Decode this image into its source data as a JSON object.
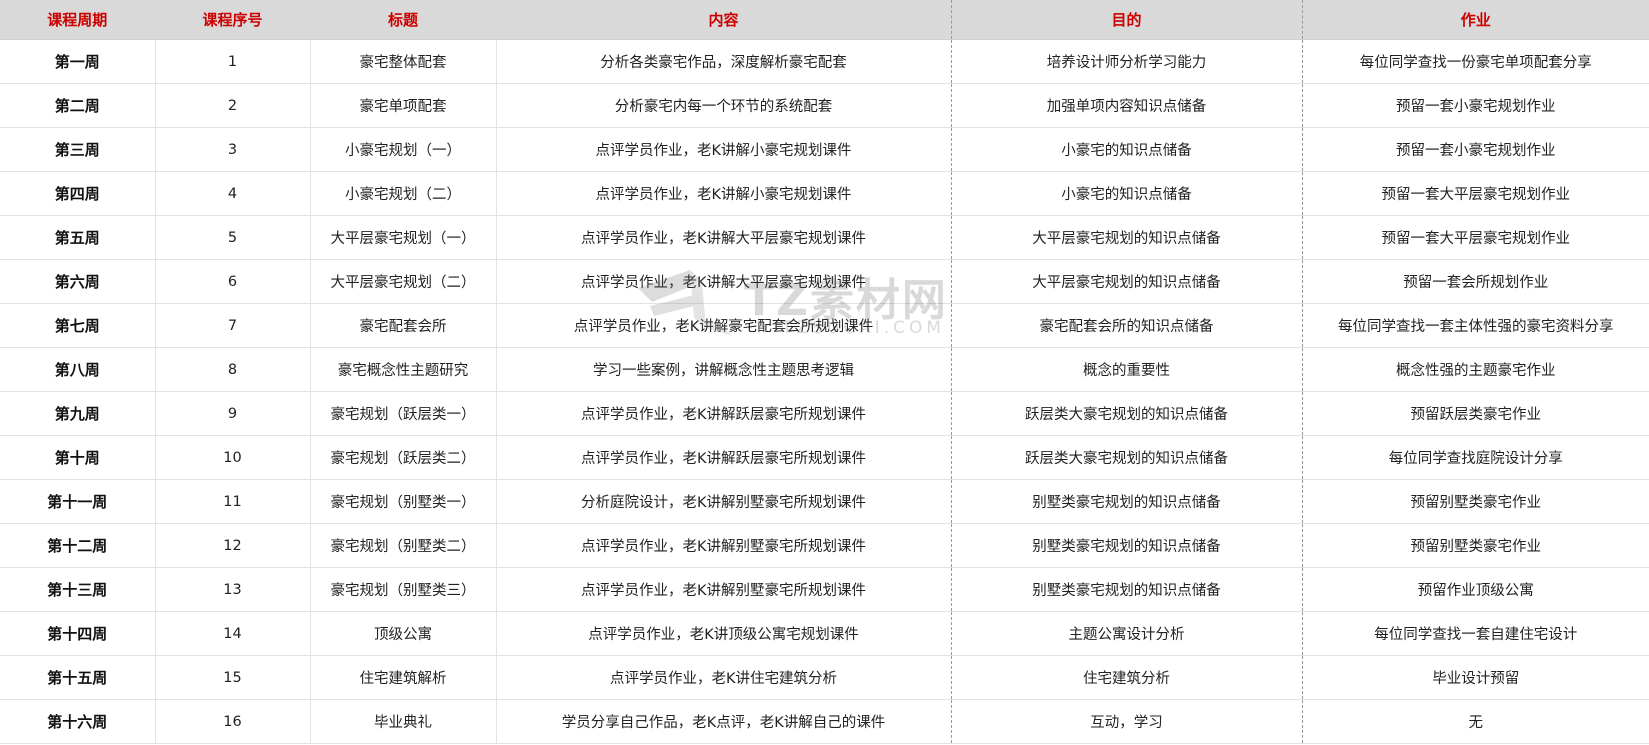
{
  "table": {
    "headers": [
      "课程周期",
      "课程序号",
      "标题",
      "内容",
      "目的",
      "作业"
    ],
    "rows": [
      [
        "第一周",
        "1",
        "豪宅整体配套",
        "分析各类豪宅作品，深度解析豪宅配套",
        "培养设计师分析学习能力",
        "每位同学查找一份豪宅单项配套分享"
      ],
      [
        "第二周",
        "2",
        "豪宅单项配套",
        "分析豪宅内每一个环节的系统配套",
        "加强单项内容知识点储备",
        "预留一套小豪宅规划作业"
      ],
      [
        "第三周",
        "3",
        "小豪宅规划（一）",
        "点评学员作业，老K讲解小豪宅规划课件",
        "小豪宅的知识点储备",
        "预留一套小豪宅规划作业"
      ],
      [
        "第四周",
        "4",
        "小豪宅规划（二）",
        "点评学员作业，老K讲解小豪宅规划课件",
        "小豪宅的知识点储备",
        "预留一套大平层豪宅规划作业"
      ],
      [
        "第五周",
        "5",
        "大平层豪宅规划（一）",
        "点评学员作业，老K讲解大平层豪宅规划课件",
        "大平层豪宅规划的知识点储备",
        "预留一套大平层豪宅规划作业"
      ],
      [
        "第六周",
        "6",
        "大平层豪宅规划（二）",
        "点评学员作业，老K讲解大平层豪宅规划课件",
        "大平层豪宅规划的知识点储备",
        "预留一套会所规划作业"
      ],
      [
        "第七周",
        "7",
        "豪宅配套会所",
        "点评学员作业，老K讲解豪宅配套会所规划课件",
        "豪宅配套会所的知识点储备",
        "每位同学查找一套主体性强的豪宅资料分享"
      ],
      [
        "第八周",
        "8",
        "豪宅概念性主题研究",
        "学习一些案例，讲解概念性主题思考逻辑",
        "概念的重要性",
        "概念性强的主题豪宅作业"
      ],
      [
        "第九周",
        "9",
        "豪宅规划（跃层类一）",
        "点评学员作业，老K讲解跃层豪宅所规划课件",
        "跃层类大豪宅规划的知识点储备",
        "预留跃层类豪宅作业"
      ],
      [
        "第十周",
        "10",
        "豪宅规划（跃层类二）",
        "点评学员作业，老K讲解跃层豪宅所规划课件",
        "跃层类大豪宅规划的知识点储备",
        "每位同学查找庭院设计分享"
      ],
      [
        "第十一周",
        "11",
        "豪宅规划（别墅类一）",
        "分析庭院设计，老K讲解别墅豪宅所规划课件",
        "别墅类豪宅规划的知识点储备",
        "预留别墅类豪宅作业"
      ],
      [
        "第十二周",
        "12",
        "豪宅规划（别墅类二）",
        "点评学员作业，老K讲解别墅豪宅所规划课件",
        "别墅类豪宅规划的知识点储备",
        "预留别墅类豪宅作业"
      ],
      [
        "第十三周",
        "13",
        "豪宅规划（别墅类三）",
        "点评学员作业，老K讲解别墅豪宅所规划课件",
        "别墅类豪宅规划的知识点储备",
        "预留作业顶级公寓"
      ],
      [
        "第十四周",
        "14",
        "顶级公寓",
        "点评学员作业，老K讲顶级公寓宅规划课件",
        "主题公寓设计分析",
        "每位同学查找一套自建住宅设计"
      ],
      [
        "第十五周",
        "15",
        "住宅建筑解析",
        "点评学员作业，老K讲住宅建筑分析",
        "住宅建筑分析",
        "毕业设计预留"
      ],
      [
        "第十六周",
        "16",
        "毕业典礼",
        "学员分享自己作品，老K点评，老K讲解自己的课件",
        "互动，学习",
        "无"
      ]
    ]
  },
  "watermark": {
    "title": "TZ素材网",
    "url": "TZSUCAI.COM"
  },
  "colors": {
    "header_bg": "#d9d9d9",
    "header_text": "#cc0000"
  }
}
